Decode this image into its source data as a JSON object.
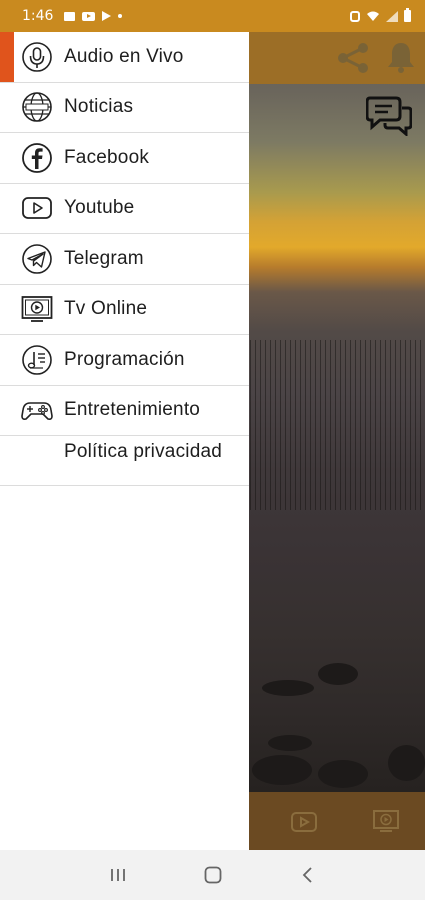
{
  "status_bar": {
    "time": "1:46",
    "icons": [
      "message-icon",
      "youtube-icon",
      "play-store-icon",
      "dot-icon",
      "alarm-icon",
      "wifi-icon",
      "signal-icon",
      "battery-icon"
    ]
  },
  "app": {
    "header_icons": [
      "share-icon",
      "bell-icon"
    ],
    "chat_icon": "chat-bubbles-icon",
    "bottom_tabs": [
      "youtube-tab-icon",
      "tv-tab-icon"
    ]
  },
  "drawer": {
    "accent_color": "#e0541c",
    "items": [
      {
        "label": "Audio en Vivo",
        "icon": "microphone-icon",
        "active": true
      },
      {
        "label": "Noticias",
        "icon": "globe-news-icon",
        "active": false
      },
      {
        "label": "Facebook",
        "icon": "facebook-icon",
        "active": false
      },
      {
        "label": "Youtube",
        "icon": "youtube-icon",
        "active": false
      },
      {
        "label": "Telegram",
        "icon": "telegram-icon",
        "active": false
      },
      {
        "label": "Tv Online",
        "icon": "tv-icon",
        "active": false
      },
      {
        "label": "Programación",
        "icon": "music-list-icon",
        "active": false
      },
      {
        "label": "Entretenimiento",
        "icon": "gamepad-icon",
        "active": false
      },
      {
        "label": "Política privacidad",
        "icon": "",
        "active": false
      }
    ]
  },
  "nav_bar": {
    "buttons": [
      "recent-apps-icon",
      "home-icon",
      "back-icon"
    ]
  },
  "colors": {
    "status_bar": "#c98a1f",
    "drawer_bg": "#ffffff",
    "divider": "#dcdcdc",
    "nav_bar": "#f2f2f2"
  }
}
